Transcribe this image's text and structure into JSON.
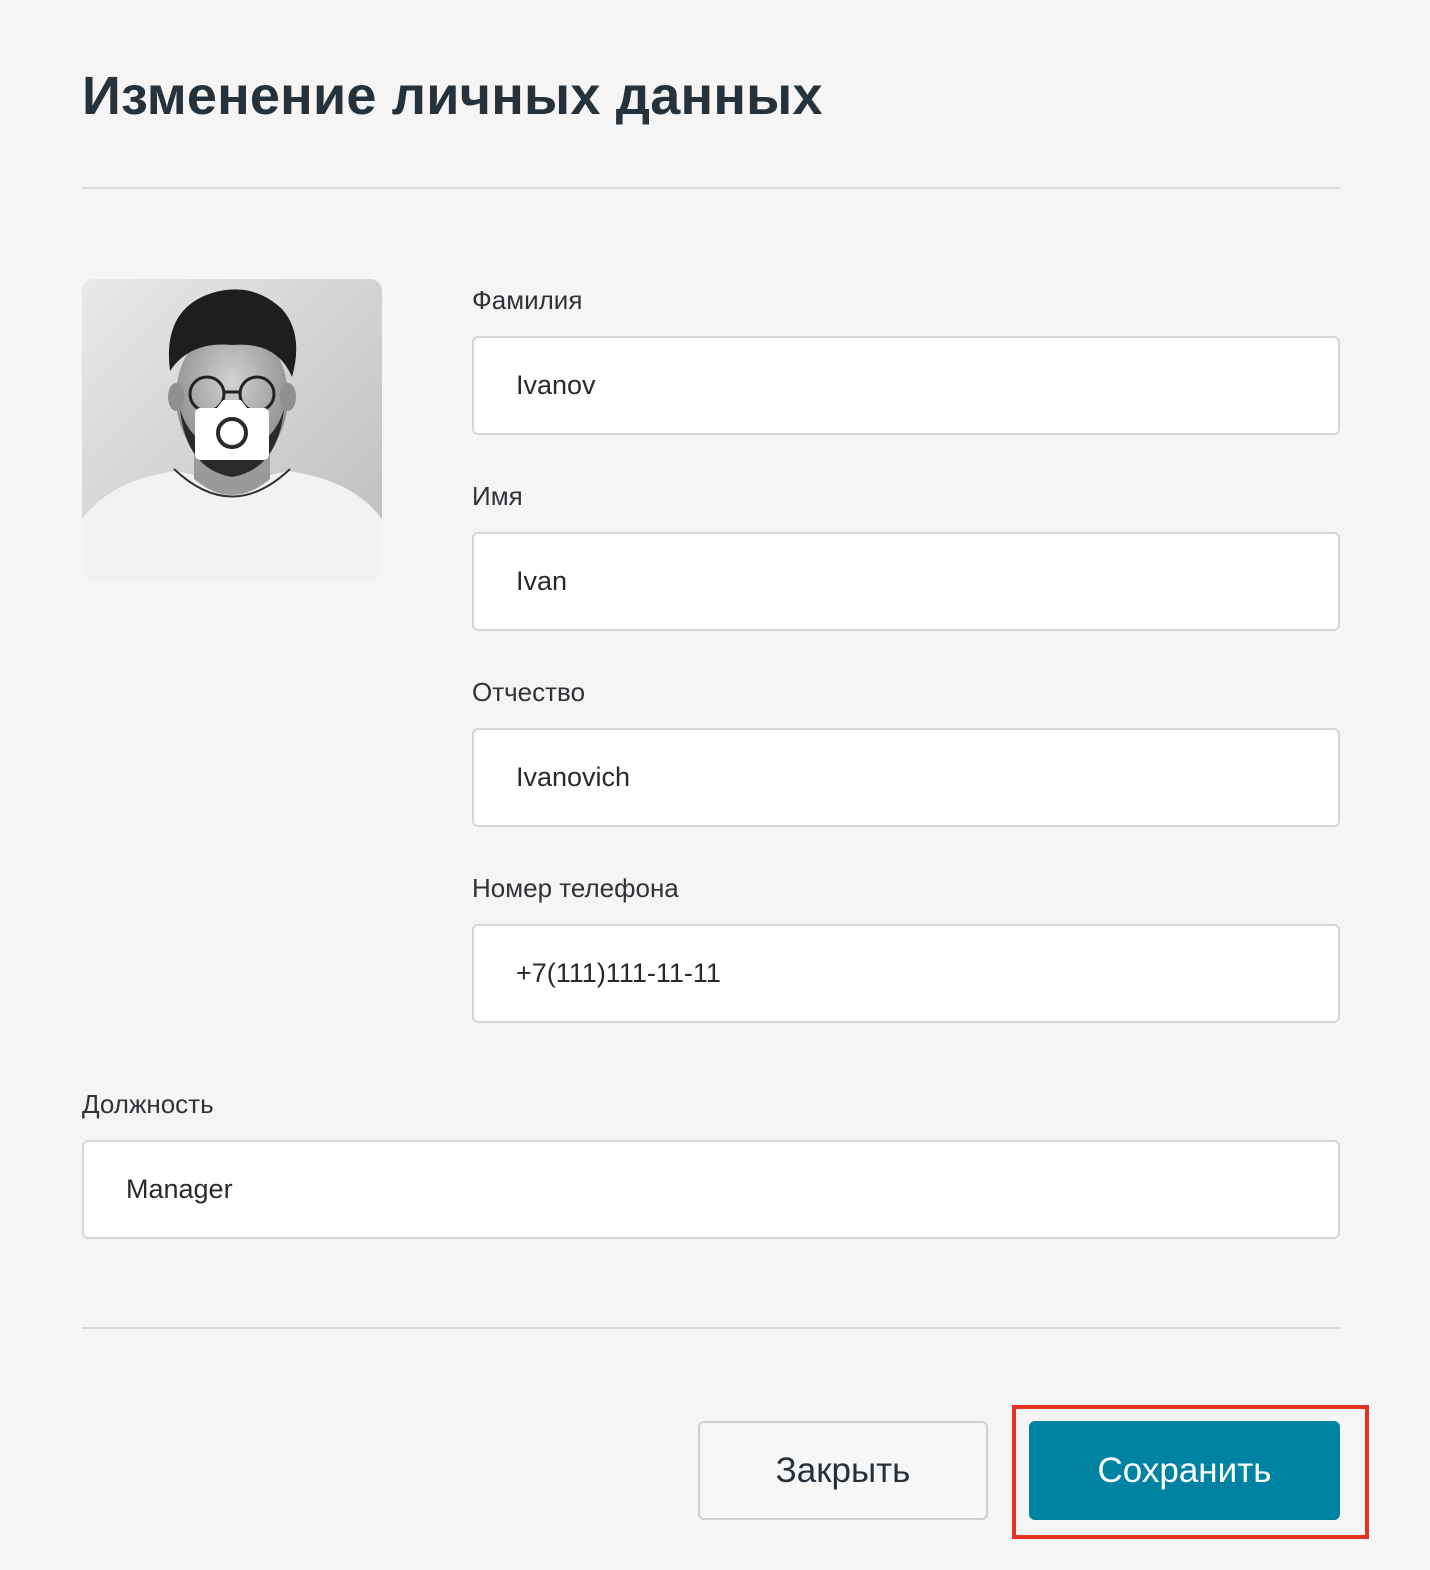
{
  "page": {
    "title": "Изменение личных данных"
  },
  "avatar": {
    "icon": "camera-icon"
  },
  "form": {
    "last_name": {
      "label": "Фамилия",
      "value": "Ivanov"
    },
    "first_name": {
      "label": "Имя",
      "value": "Ivan"
    },
    "patronymic": {
      "label": "Отчество",
      "value": "Ivanovich"
    },
    "phone": {
      "label": "Номер телефона",
      "value": "+7(111)111-11-11"
    },
    "position": {
      "label": "Должность",
      "value": "Manager"
    }
  },
  "actions": {
    "close_label": "Закрыть",
    "save_label": "Сохранить"
  },
  "colors": {
    "primary": "#0083a3",
    "highlight": "#e5321f",
    "background": "#f5f5f5"
  }
}
